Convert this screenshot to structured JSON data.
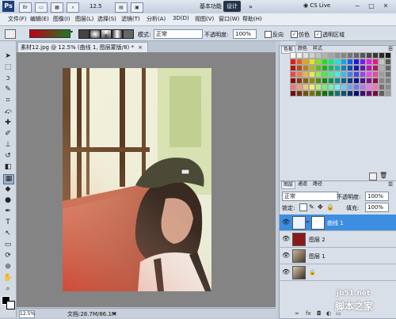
{
  "app": {
    "logo": "Ps",
    "zoom": "12.5",
    "workspaces": [
      "基本功能",
      "设计"
    ],
    "more": "»",
    "cs_live": "CS Live",
    "window_buttons": [
      "−",
      "□",
      "✕"
    ]
  },
  "menu": [
    "文件(F)",
    "编辑(E)",
    "图像(I)",
    "图层(L)",
    "选择(S)",
    "滤镜(T)",
    "分析(A)",
    "3D(D)",
    "视图(V)",
    "窗口(W)",
    "帮助(H)"
  ],
  "options": {
    "mode_label": "模式:",
    "mode_value": "正常",
    "opacity_label": "不透明度:",
    "opacity_value": "100%",
    "reverse_label": "反向",
    "dither_label": "仿色",
    "transparency_label": "透明区域",
    "reverse_checked": false,
    "dither_checked": true,
    "transparency_checked": true
  },
  "document": {
    "tab_title": "素材12.jpg @ 12.5% (曲线 1, 图层蒙版/8) *",
    "tab_close": "×",
    "zoom": "12.5%",
    "doc_size": "文档:28.7M/86.1M"
  },
  "swatch_panel": {
    "tabs": [
      "色板",
      "颜色",
      "样式"
    ]
  },
  "layers_panel": {
    "tabs": [
      "图层",
      "通道",
      "路径"
    ],
    "blend_mode": "正常",
    "opacity_label": "不透明度:",
    "opacity_value": "100%",
    "lock_label": "锁定:",
    "fill_label": "填充:",
    "fill_value": "100%",
    "layers": [
      {
        "name": "曲线 1",
        "selected": true,
        "thumb": "curves"
      },
      {
        "name": "图层 2",
        "selected": false,
        "thumb": "red"
      },
      {
        "name": "图层 1",
        "selected": false,
        "thumb": "photo"
      },
      {
        "name": "",
        "selected": false,
        "thumb": "photo"
      }
    ]
  },
  "watermark": {
    "url": "jb51.net",
    "name": "脚本之家"
  }
}
